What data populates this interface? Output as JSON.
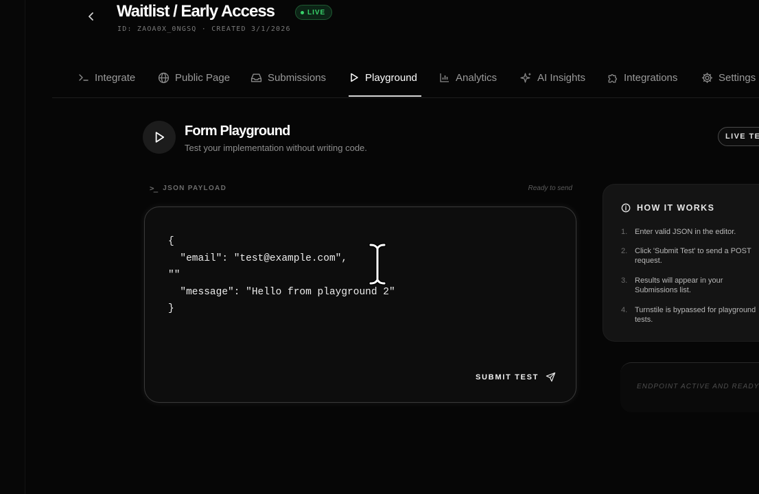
{
  "header": {
    "title": "Waitlist / Early Access",
    "status_badge": "LIVE",
    "meta": "ID: ZAOA0X_0NGSQ · CREATED 3/1/2026"
  },
  "tabs": [
    {
      "label": "Integrate",
      "icon": "terminal-icon"
    },
    {
      "label": "Public Page",
      "icon": "globe-icon"
    },
    {
      "label": "Submissions",
      "icon": "inbox-icon"
    },
    {
      "label": "Playground",
      "icon": "play-icon",
      "active": true
    },
    {
      "label": "Analytics",
      "icon": "bar-chart-icon"
    },
    {
      "label": "AI Insights",
      "icon": "sparkles-icon"
    },
    {
      "label": "Integrations",
      "icon": "puzzle-icon"
    },
    {
      "label": "Settings",
      "icon": "gear-icon"
    }
  ],
  "playground": {
    "title": "Form Playground",
    "subtitle": "Test your implementation without writing code.",
    "live_test_label": "LIVE TEST"
  },
  "payload": {
    "label": "JSON PAYLOAD",
    "status": "Ready to send",
    "editor_value": "{\n  \"email\": \"test@example.com\",\n\"\"\n  \"message\": \"Hello from playground 2\"\n}",
    "submit_label": "SUBMIT TEST"
  },
  "how_it_works": {
    "title": "HOW IT WORKS",
    "steps": [
      {
        "num": "1.",
        "text": "Enter valid JSON in the editor."
      },
      {
        "num": "2.",
        "text": "Click 'Submit Test' to send a POST request."
      },
      {
        "num": "3.",
        "text": "Results will appear in your Submissions list."
      },
      {
        "num": "4.",
        "text": "Turnstile is bypassed for playground tests."
      }
    ]
  },
  "endpoint": {
    "status": "ENDPOINT ACTIVE AND READY"
  },
  "colors": {
    "background": "#060606",
    "live_green": "#38d26a",
    "text_primary": "#ffffff",
    "text_muted": "#9a9a9a"
  }
}
